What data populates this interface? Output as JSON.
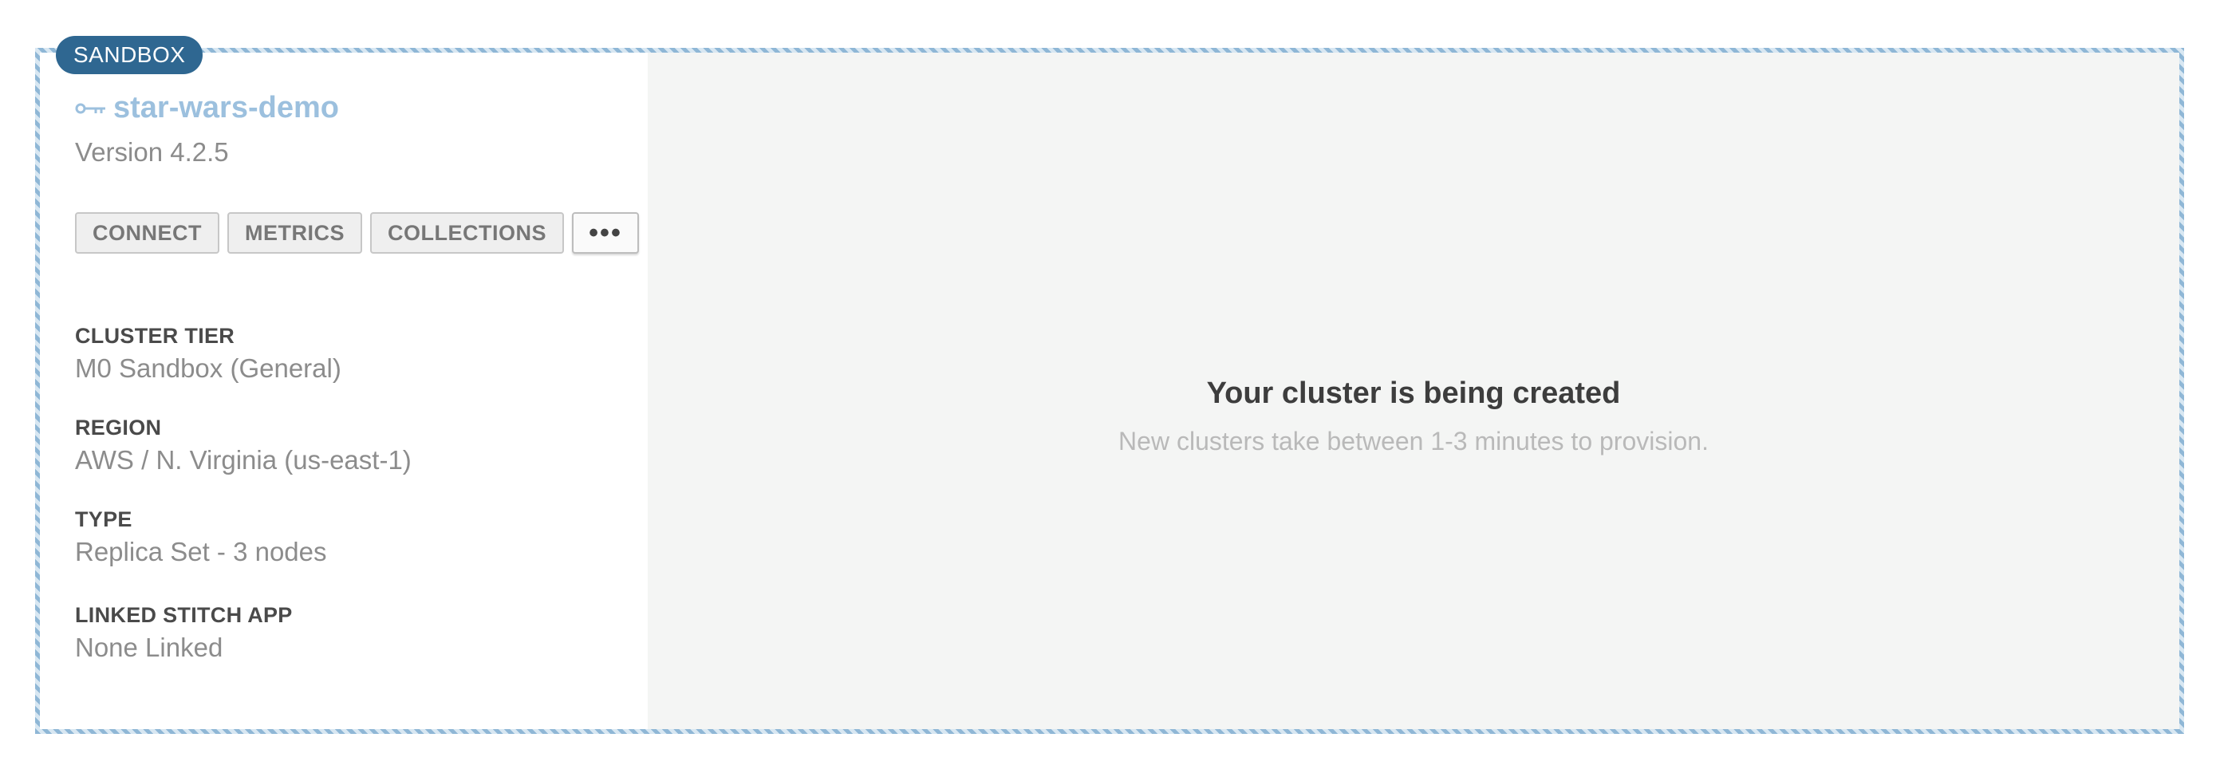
{
  "badge": "SANDBOX",
  "cluster": {
    "name": "star-wars-demo",
    "version": "Version 4.2.5"
  },
  "actions": {
    "connect": "CONNECT",
    "metrics": "METRICS",
    "collections": "COLLECTIONS",
    "more": "•••"
  },
  "details": [
    {
      "label": "CLUSTER TIER",
      "value": "M0 Sandbox (General)"
    },
    {
      "label": "REGION",
      "value": "AWS / N. Virginia (us-east-1)"
    },
    {
      "label": "TYPE",
      "value": "Replica Set - 3 nodes"
    },
    {
      "label": "LINKED STITCH APP",
      "value": "None Linked"
    }
  ],
  "status": {
    "title": "Your cluster is being created",
    "subtitle": "New clusters take between 1-3 minutes to provision."
  },
  "colors": {
    "badge": "#2f6791",
    "cluster_name": "#9cc0de",
    "panel_bg": "#f4f5f4"
  },
  "icons": {
    "cluster": "key-icon"
  }
}
